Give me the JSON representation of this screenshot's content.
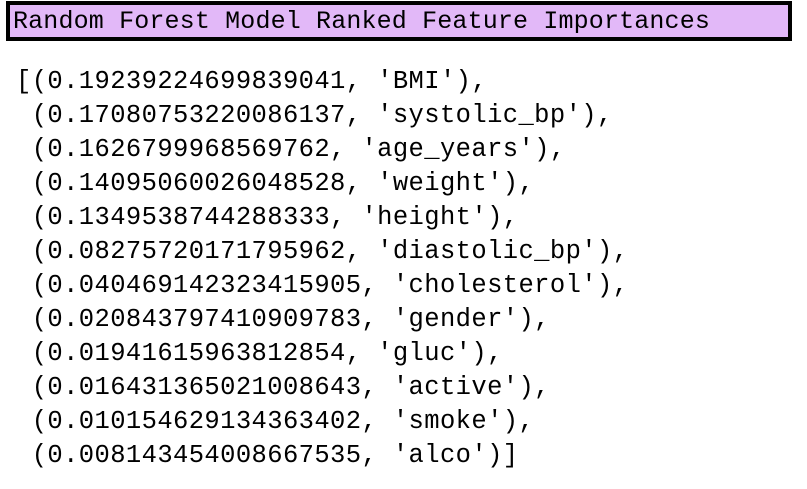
{
  "header": {
    "title": "Random Forest Model Ranked Feature Importances"
  },
  "output": {
    "lines": [
      "[(0.19239224699839041, 'BMI'),",
      " (0.17080753220086137, 'systolic_bp'),",
      " (0.1626799968569762, 'age_years'),",
      " (0.14095060026048528, 'weight'),",
      " (0.1349538744288333, 'height'),",
      " (0.08275720171795962, 'diastolic_bp'),",
      " (0.040469142323415905, 'cholesterol'),",
      " (0.020843797410909783, 'gender'),",
      " (0.01941615963812854, 'gluc'),",
      " (0.016431365021008643, 'active'),",
      " (0.010154629134363402, 'smoke'),",
      " (0.008143454008667535, 'alco')]"
    ]
  }
}
